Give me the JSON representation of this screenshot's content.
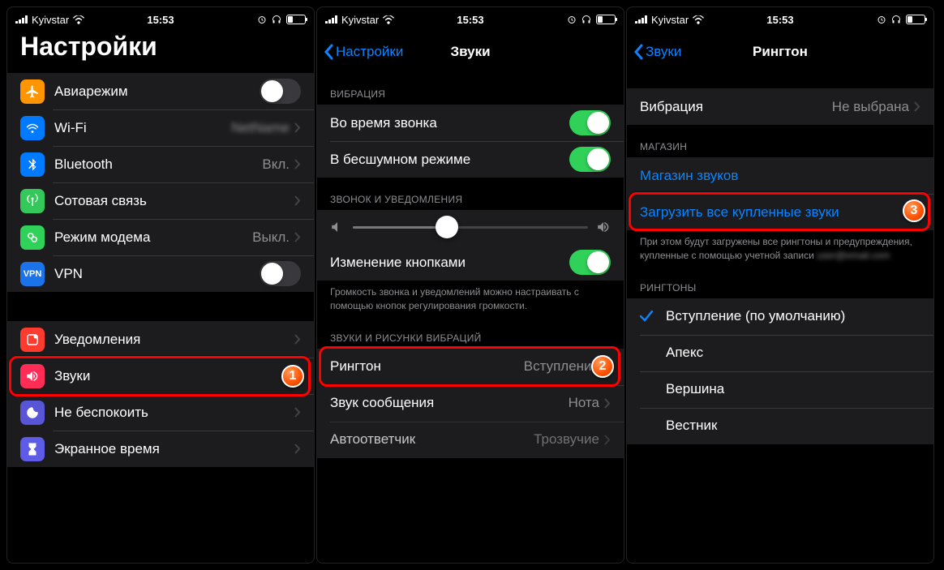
{
  "statusBar": {
    "carrier": "Kyivstar",
    "time": "15:53"
  },
  "screen1": {
    "title": "Настройки",
    "items": {
      "airplane": "Авиарежим",
      "wifi": "Wi-Fi",
      "wifi_value": "",
      "bluetooth": "Bluetooth",
      "bluetooth_value": "Вкл.",
      "cellular": "Сотовая связь",
      "hotspot": "Режим модема",
      "hotspot_value": "Выкл.",
      "vpn": "VPN",
      "notifications": "Уведомления",
      "sounds": "Звуки",
      "dnd": "Не беспокоить",
      "screentime": "Экранное время"
    }
  },
  "screen2": {
    "back": "Настройки",
    "title": "Звуки",
    "sections": {
      "vibration": "ВИБРАЦИЯ",
      "ringer": "ЗВОНОК И УВЕДОМЛЕНИЯ",
      "patterns": "ЗВУКИ И РИСУНКИ ВИБРАЦИЙ"
    },
    "rows": {
      "vibOnRing": "Во время звонка",
      "vibOnSilent": "В бесшумном режиме",
      "changeWithButtons": "Изменение кнопками",
      "ringtone": "Рингтон",
      "ringtone_value": "Вступление",
      "textTone": "Звук сообщения",
      "textTone_value": "Нота",
      "voicemail": "Автоответчик",
      "voicemail_value": "Трозвучие"
    },
    "footer_buttons": "Громкость звонка и уведомлений можно настраивать с помощью кнопок регулирования громкости."
  },
  "screen3": {
    "back": "Звуки",
    "title": "Рингтон",
    "rows": {
      "vibration": "Вибрация",
      "vibration_value": "Не выбрана",
      "toneStore": "Магазин звуков",
      "downloadAll": "Загрузить все купленные звуки"
    },
    "sections": {
      "store": "МАГАЗИН",
      "ringtones": "РИНГТОНЫ"
    },
    "footer_download": "При этом будут загружены все рингтоны и предупреждения, купленные с помощью учетной записи",
    "ringtones": [
      "Вступление (по умолчанию)",
      "Апекс",
      "Вершина",
      "Вестник"
    ]
  },
  "badges": {
    "b1": "1",
    "b2": "2",
    "b3": "3"
  }
}
